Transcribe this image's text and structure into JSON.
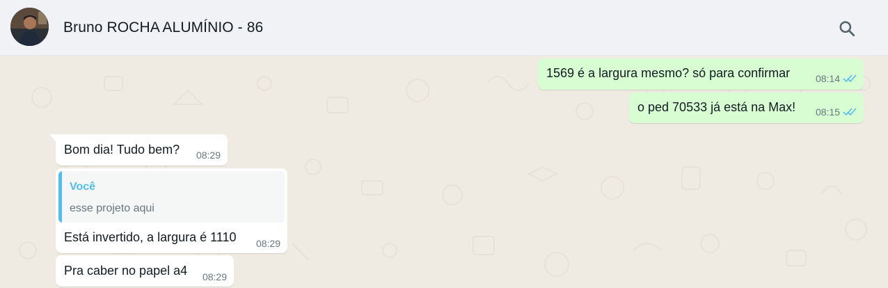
{
  "header": {
    "contact_name": "Bruno ROCHA ALUMÍNIO - 86",
    "avatar_icon": "contact-photo",
    "search_icon": "search-icon"
  },
  "colors": {
    "header_bg": "#f0f2f5",
    "chat_bg": "#efeae2",
    "outgoing_bubble": "#d9fdd3",
    "incoming_bubble": "#ffffff",
    "read_ticks": "#53bdeb",
    "quote_accent": "#53bdeb"
  },
  "messages": [
    {
      "direction": "outgoing",
      "text": "1569 é a largura mesmo? só para confirmar",
      "time": "08:14",
      "status": "read"
    },
    {
      "direction": "outgoing",
      "text": "o ped 70533 já está na Max!",
      "time": "08:15",
      "status": "read"
    },
    {
      "direction": "incoming",
      "text": "Bom dia! Tudo bem?",
      "time": "08:29"
    },
    {
      "direction": "incoming",
      "text": "Está invertido, a largura é 1110",
      "time": "08:29",
      "quoted": {
        "author": "Você",
        "text": "esse projeto aqui"
      }
    },
    {
      "direction": "incoming",
      "text": "Pra caber no papel a4",
      "time": "08:29"
    }
  ]
}
